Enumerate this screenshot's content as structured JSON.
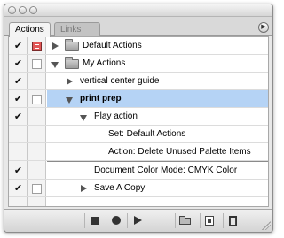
{
  "window": {
    "tabs": [
      {
        "label": "Actions",
        "active": true
      },
      {
        "label": "Links",
        "active": false
      }
    ]
  },
  "rows": [
    {
      "label": "Default Actions"
    },
    {
      "label": "My Actions"
    },
    {
      "label": "vertical center guide"
    },
    {
      "label": "print prep"
    },
    {
      "label": "Play action"
    },
    {
      "label": "Set: Default Actions"
    },
    {
      "label": "Action: Delete Unused Palette Items"
    },
    {
      "label": "Document Color Mode: CMYK Color"
    },
    {
      "label": "Save A Copy"
    }
  ],
  "colors": {
    "selection": "#b5d3f5",
    "dialog_toggle_on": "#e25656"
  },
  "toolbar": {
    "buttons": [
      "stop-icon",
      "record-icon",
      "play-icon",
      "new-set-icon",
      "new-action-icon",
      "delete-icon"
    ]
  }
}
